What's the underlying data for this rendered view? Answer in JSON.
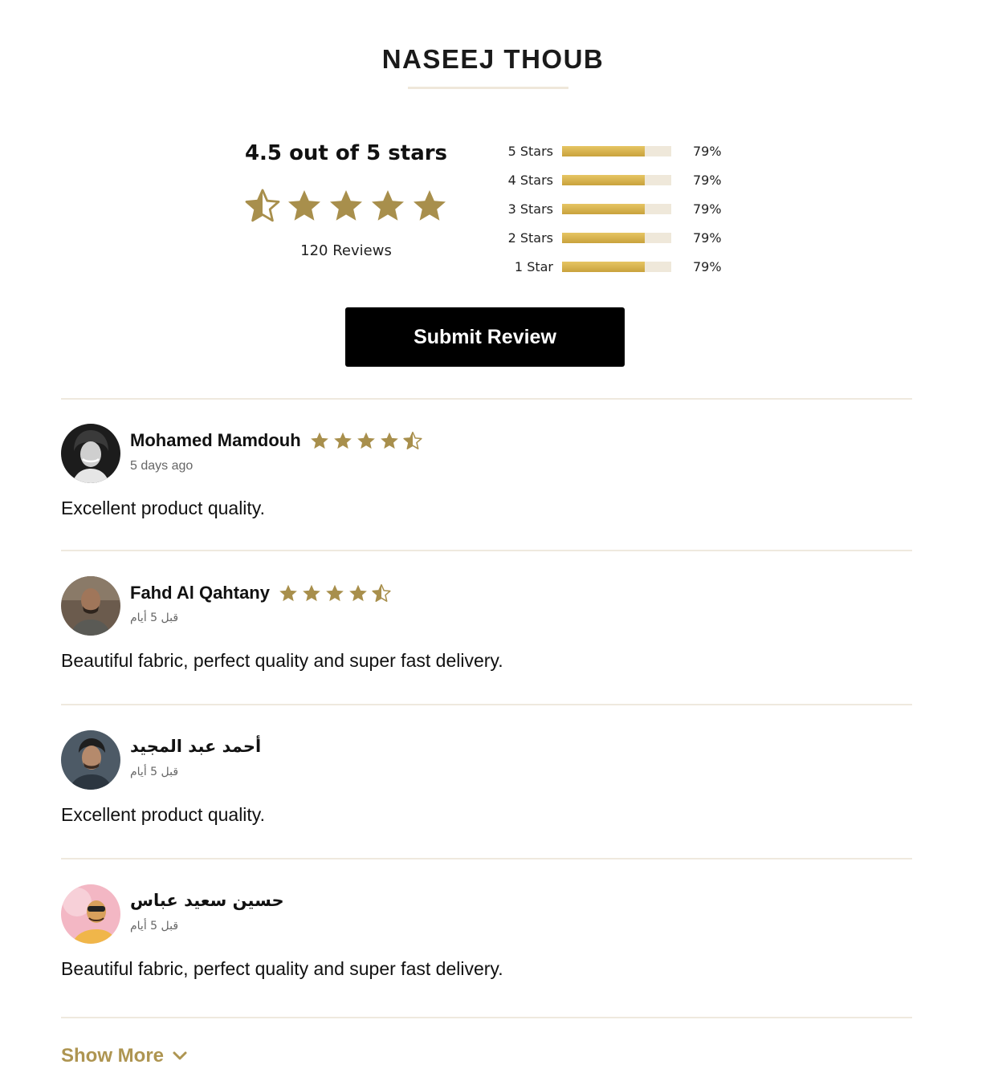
{
  "product": {
    "title": "NASEEJ THOUB"
  },
  "summary": {
    "average_text": "4.5 out of 5 stars",
    "rating": 4.5,
    "reviews_count": "120 Reviews"
  },
  "distribution": [
    {
      "label": "5 Stars",
      "percent_text": "79%",
      "fill_fraction": 0.76
    },
    {
      "label": "4 Stars",
      "percent_text": "79%",
      "fill_fraction": 0.76
    },
    {
      "label": "3 Stars",
      "percent_text": "79%",
      "fill_fraction": 0.76
    },
    {
      "label": "2 Stars",
      "percent_text": "79%",
      "fill_fraction": 0.76
    },
    {
      "label": "1 Star",
      "percent_text": "79%",
      "fill_fraction": 0.76
    }
  ],
  "actions": {
    "submit_label": "Submit Review",
    "show_more_label": "Show More"
  },
  "reviews": [
    {
      "name": "Mohamed Mamdouh",
      "date": "5 days ago",
      "text": "Excellent product quality.",
      "rating": 4.5
    },
    {
      "name": "Fahd Al Qahtany",
      "date": "قبل 5 أيام",
      "text": "Beautiful fabric, perfect quality and super fast delivery.",
      "rating": 4.5
    },
    {
      "name": "أحمد عبد المجيد",
      "date": "قبل 5 أيام",
      "text": "Excellent product quality."
    },
    {
      "name": "حسين سعيد عباس",
      "date": "قبل 5 أيام",
      "text": "Beautiful fabric, perfect quality and super fast delivery."
    }
  ],
  "colors": {
    "star": "#a88f4c",
    "bar_fill": "#d6b24a",
    "bar_track": "#efe8da",
    "button": "#000000",
    "show_more": "#ae9551"
  },
  "icons": {
    "star": "star-icon",
    "half_star": "star-half-icon",
    "outline_star": "star-outline-icon",
    "chevron": "chevron-down-icon"
  }
}
